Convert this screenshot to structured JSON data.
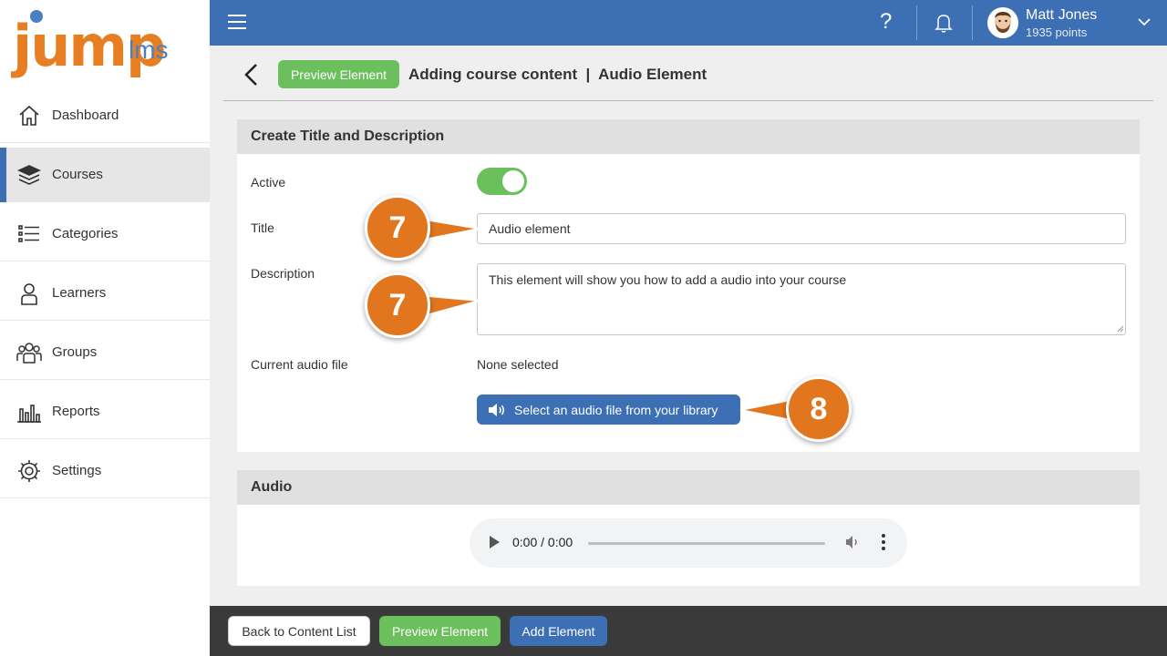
{
  "brand": {
    "logo_main": "jump",
    "logo_sub": "lms"
  },
  "sidebar": {
    "items": [
      {
        "label": "Dashboard",
        "icon": "home-icon"
      },
      {
        "label": "Courses",
        "icon": "books-icon",
        "active": true
      },
      {
        "label": "Categories",
        "icon": "list-icon"
      },
      {
        "label": "Learners",
        "icon": "person-icon"
      },
      {
        "label": "Groups",
        "icon": "group-icon"
      },
      {
        "label": "Reports",
        "icon": "chart-icon"
      },
      {
        "label": "Settings",
        "icon": "gear-icon"
      }
    ]
  },
  "topbar": {
    "help_icon": "?",
    "user": {
      "name": "Matt Jones",
      "points": "1935 points"
    },
    "color": "#3d6fb5"
  },
  "header": {
    "preview_button": "Preview Element",
    "title": "Adding course content  |  Audio Element"
  },
  "form": {
    "section_title": "Create Title and Description",
    "active_label": "Active",
    "active_value": true,
    "title_label": "Title",
    "title_value": "Audio element",
    "description_label": "Description",
    "description_value": "This element will show you how to add a audio into your course",
    "audio_file_label": "Current audio file",
    "audio_file_value": "None selected",
    "select_button": "Select an audio file from your library"
  },
  "audio_section": {
    "title": "Audio",
    "time": "0:00 / 0:00"
  },
  "callouts": [
    "7",
    "7",
    "8"
  ],
  "footer": {
    "back_button": "Back to Content List",
    "preview_button": "Preview Element",
    "add_button": "Add Element"
  },
  "colors": {
    "accent_blue": "#3d6fb5",
    "accent_green": "#6cbf5d",
    "callout_orange": "#e2761e"
  }
}
